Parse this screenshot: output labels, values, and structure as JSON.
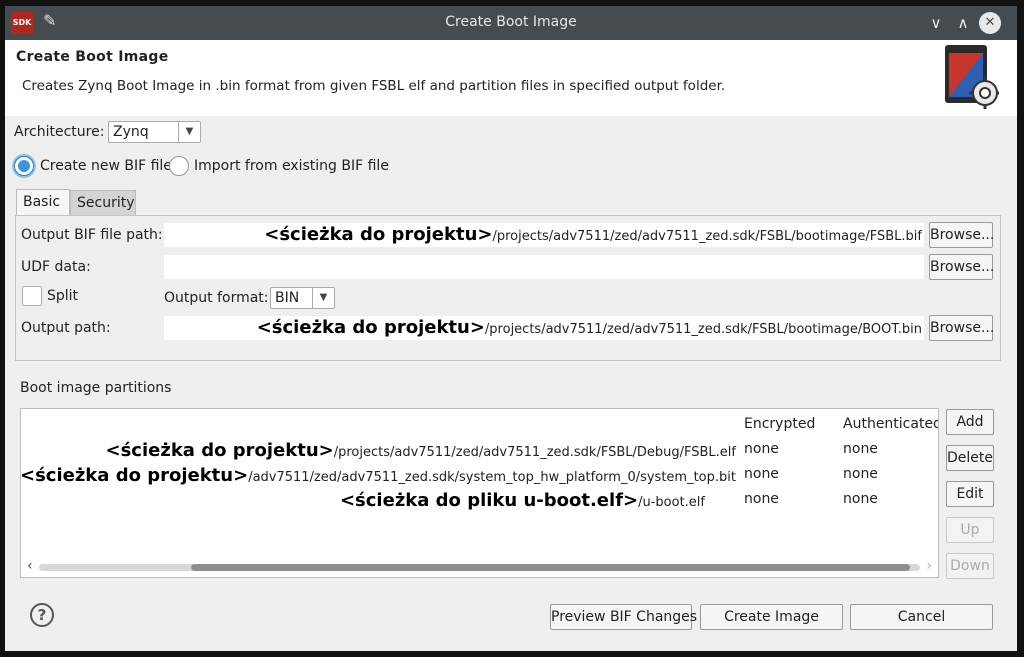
{
  "window": {
    "title": "Create Boot Image",
    "logo_text": "SDK",
    "icons": {
      "pin": "pin-icon",
      "minimize": "chevron-down-icon",
      "maximize": "chevron-up-icon",
      "close": "close-icon"
    }
  },
  "header": {
    "title": "Create Boot Image",
    "description": "Creates Zynq Boot Image in .bin format from given FSBL elf and partition files in specified output folder.",
    "icon": "boot-image-gear-icon"
  },
  "architecture": {
    "label": "Architecture:",
    "value": "Zynq"
  },
  "bif_mode": {
    "options": [
      {
        "label": "Create new BIF file",
        "selected": true
      },
      {
        "label": "Import from existing BIF file",
        "selected": false
      }
    ]
  },
  "tabs": [
    {
      "label": "Basic",
      "active": true
    },
    {
      "label": "Security",
      "active": false
    }
  ],
  "basic": {
    "output_bif": {
      "label": "Output BIF file path:",
      "prefix": "<ścieżka do projektu>",
      "value": "/projects/adv7511/zed/adv7511_zed.sdk/FSBL/bootimage/FSBL.bif",
      "browse": "Browse..."
    },
    "udf": {
      "label": "UDF data:",
      "value": "",
      "browse": "Browse..."
    },
    "split": {
      "label": "Split",
      "checked": false
    },
    "output_format": {
      "label": "Output format:",
      "value": "BIN"
    },
    "output_path": {
      "label": "Output path:",
      "prefix": "<ścieżka do projektu>",
      "value": "/projects/adv7511/zed/adv7511_zed.sdk/FSBL/bootimage/BOOT.bin",
      "browse": "Browse..."
    }
  },
  "partitions": {
    "title": "Boot image partitions",
    "columns": [
      "Encrypted",
      "Authenticated"
    ],
    "rows": [
      {
        "prefix": "<ścieżka do projektu>",
        "path": "/projects/adv7511/zed/adv7511_zed.sdk/FSBL/Debug/FSBL.elf",
        "encrypted": "none",
        "authenticated": "none"
      },
      {
        "prefix": "<ścieżka do projektu>",
        "path": "/adv7511/zed/adv7511_zed.sdk/system_top_hw_platform_0/system_top.bit",
        "encrypted": "none",
        "authenticated": "none"
      },
      {
        "prefix": "<ścieżka do pliku u-boot.elf>",
        "path": "/u-boot.elf",
        "encrypted": "none",
        "authenticated": "none"
      }
    ],
    "buttons": {
      "add": "Add",
      "delete": "Delete",
      "edit": "Edit",
      "up": "Up",
      "down": "Down"
    }
  },
  "footer": {
    "help": "?",
    "preview": "Preview BIF Changes",
    "create": "Create Image",
    "cancel": "Cancel"
  }
}
